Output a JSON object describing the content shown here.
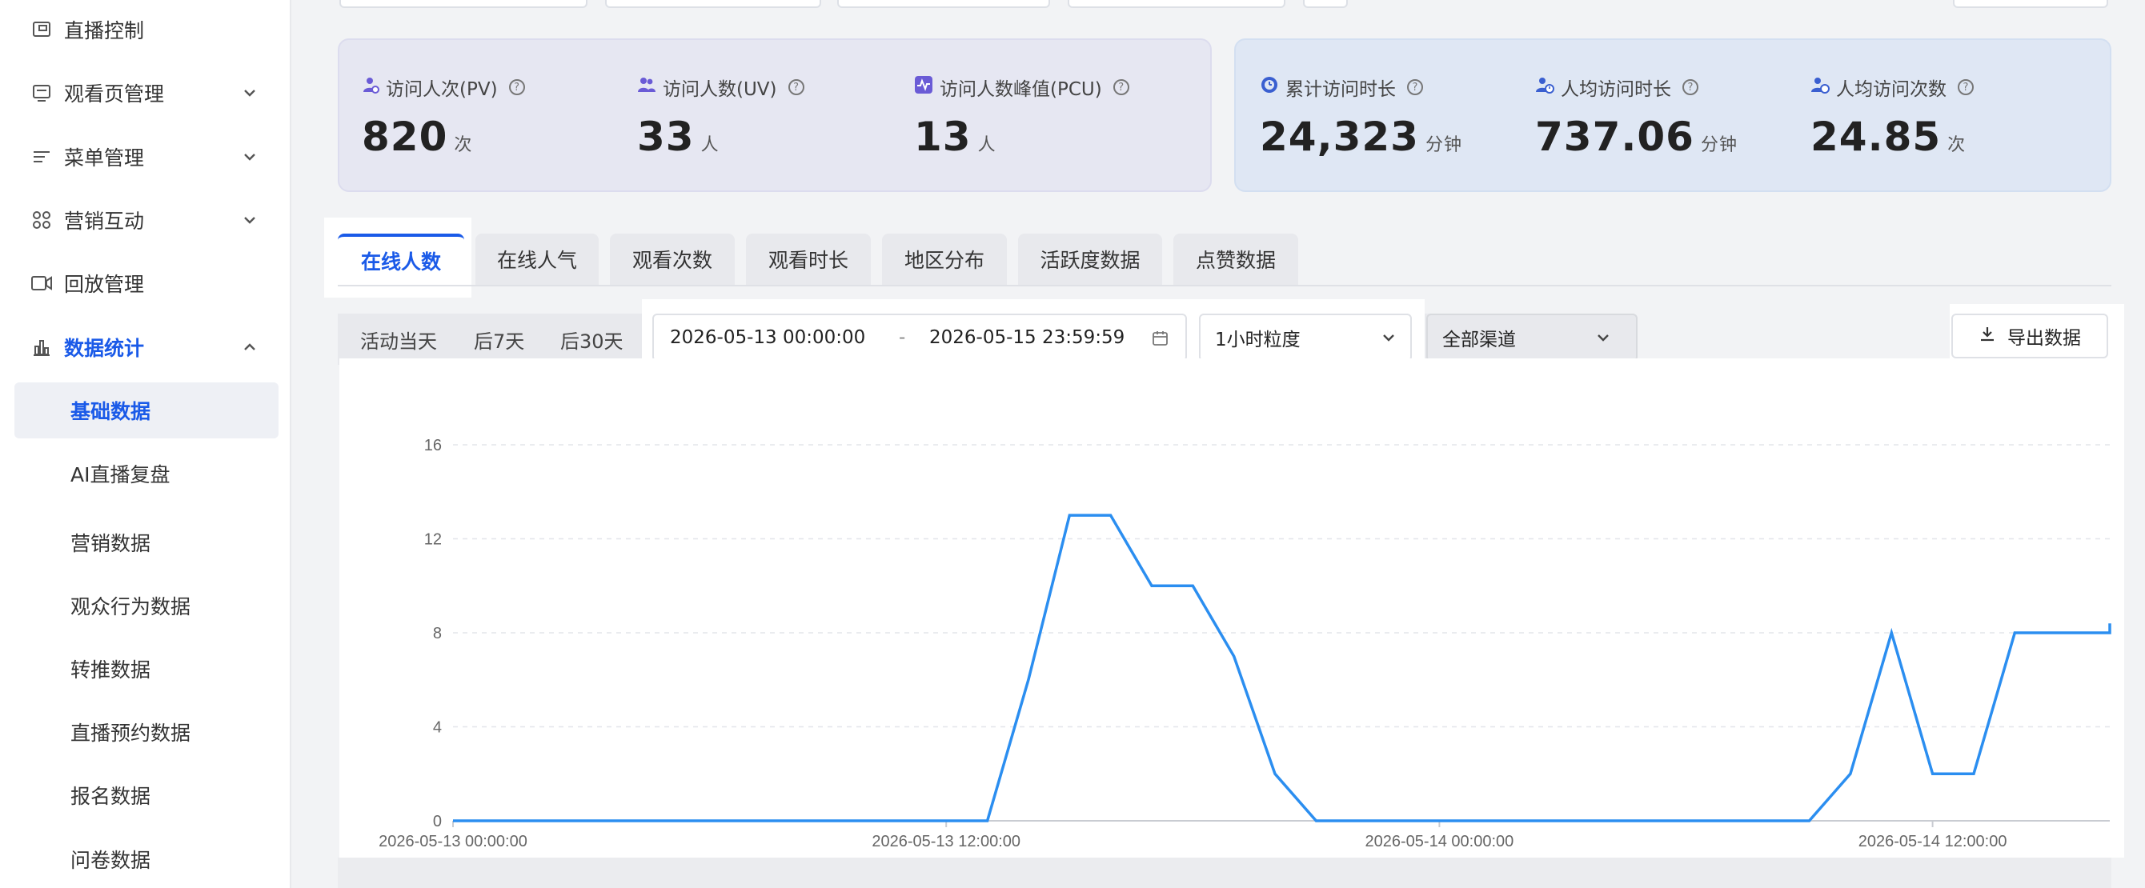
{
  "sidebar": {
    "items": [
      {
        "label": "直播控制",
        "icon": "live-control-icon",
        "has_chevron": false
      },
      {
        "label": "观看页管理",
        "icon": "watch-page-icon",
        "has_chevron": true
      },
      {
        "label": "菜单管理",
        "icon": "menu-manage-icon",
        "has_chevron": true
      },
      {
        "label": "营销互动",
        "icon": "marketing-icon",
        "has_chevron": true
      },
      {
        "label": "回放管理",
        "icon": "playback-icon",
        "has_chevron": false
      },
      {
        "label": "数据统计",
        "icon": "bar-chart-icon",
        "has_chevron": true,
        "expanded": true,
        "active": true
      }
    ],
    "sub_items": [
      {
        "label": "基础数据",
        "selected": true
      },
      {
        "label": "AI直播复盘"
      },
      {
        "label": "营销数据"
      },
      {
        "label": "观众行为数据"
      },
      {
        "label": "转推数据"
      },
      {
        "label": "直播预约数据"
      },
      {
        "label": "报名数据"
      },
      {
        "label": "问卷数据"
      }
    ]
  },
  "stats_left": [
    {
      "label": "访问人次(PV)",
      "value": "820",
      "unit": "次",
      "icon": "user-visit-icon"
    },
    {
      "label": "访问人数(UV)",
      "value": "33",
      "unit": "人",
      "icon": "users-icon"
    },
    {
      "label": "访问人数峰值(PCU)",
      "value": "13",
      "unit": "人",
      "icon": "pulse-icon"
    }
  ],
  "stats_right": [
    {
      "label": "累计访问时长",
      "value": "24,323",
      "unit": "分钟",
      "icon": "clock-icon"
    },
    {
      "label": "人均访问时长",
      "value": "737.06",
      "unit": "分钟",
      "icon": "user-time-icon"
    },
    {
      "label": "人均访问次数",
      "value": "24.85",
      "unit": "次",
      "icon": "user-count-icon"
    }
  ],
  "tabs": [
    {
      "label": "在线人数",
      "active": true
    },
    {
      "label": "在线人气"
    },
    {
      "label": "观看次数"
    },
    {
      "label": "观看时长"
    },
    {
      "label": "地区分布"
    },
    {
      "label": "活跃度数据"
    },
    {
      "label": "点赞数据"
    }
  ],
  "filters": {
    "quick": [
      "活动当天",
      "后7天",
      "后30天"
    ],
    "date_start": "2026-05-13 00:00:00",
    "date_separator": "-",
    "date_end": "2026-05-15 23:59:59",
    "granularity": "1小时粒度",
    "channel": "全部渠道",
    "export_label": "导出数据"
  },
  "colors": {
    "accent": "#1a5ae8",
    "line": "#2b8ef0",
    "card_left": "#e6e7f2",
    "card_right": "#dfe7f4"
  },
  "chart_data": {
    "type": "line",
    "title": "",
    "xlabel": "",
    "ylabel": "",
    "ylim": [
      0,
      16
    ],
    "y_ticks": [
      0,
      4,
      8,
      12,
      16
    ],
    "x_tick_labels": [
      "2026-05-13 00:00:00",
      "2026-05-13 12:00:00",
      "2026-05-14 00:00:00",
      "2026-05-14 12:00:00"
    ],
    "grid": true,
    "series": [
      {
        "values": [
          0,
          0,
          0,
          0,
          0,
          0,
          0,
          0,
          0,
          0,
          0,
          0,
          0,
          0,
          6,
          13,
          13,
          10,
          10,
          7,
          2,
          0,
          0,
          0,
          0,
          0,
          0,
          0,
          0,
          0,
          0,
          0,
          0,
          0,
          2,
          8,
          2,
          2,
          8,
          8,
          8,
          8,
          8.4
        ]
      }
    ]
  }
}
